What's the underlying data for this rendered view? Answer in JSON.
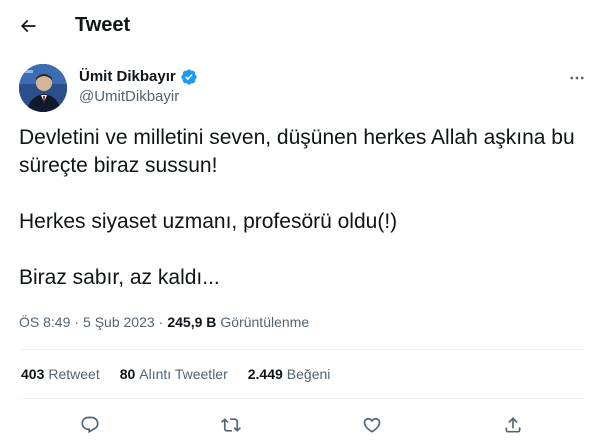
{
  "header": {
    "title": "Tweet",
    "back_icon": "arrow-left-icon"
  },
  "author": {
    "name": "Ümit Dikbayır",
    "handle": "@UmitDikbayir",
    "verified": true,
    "verified_color": "#1d9bf0"
  },
  "tweet": {
    "lines": [
      "Devletini ve milletini seven, düşünen herkes Allah aşkına bu süreçte biraz sussun!",
      "Herkes siyaset uzmanı, profesörü oldu(!)",
      "Biraz sabır, az kaldı..."
    ]
  },
  "meta": {
    "time": "ÖS 8:49",
    "separator": "·",
    "date": "5 Şub 2023",
    "views_count": "245,9 B",
    "views_label": "Görüntülenme"
  },
  "stats": {
    "retweets_count": "403",
    "retweets_label": "Retweet",
    "quotes_count": "80",
    "quotes_label": "Alıntı Tweetler",
    "likes_count": "2.449",
    "likes_label": "Beğeni"
  },
  "actions": [
    "reply-icon",
    "retweet-icon",
    "like-icon",
    "share-icon"
  ],
  "colors": {
    "text": "#0f1419",
    "secondary": "#536471",
    "divider": "#eff3f4"
  }
}
